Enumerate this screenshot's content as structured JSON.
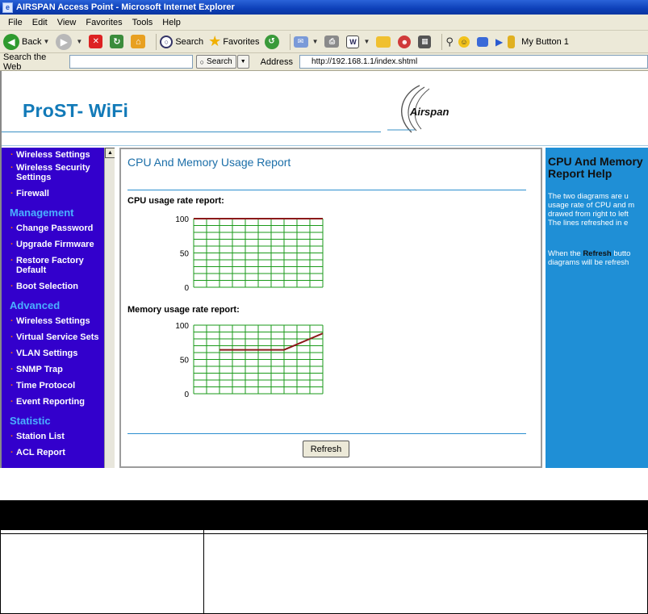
{
  "browser": {
    "title": "AIRSPAN Access Point - Microsoft Internet Explorer",
    "menu": [
      "File",
      "Edit",
      "View",
      "Favorites",
      "Tools",
      "Help"
    ],
    "toolbar": {
      "back_label": "Back",
      "search_label": "Search",
      "favorites_label": "Favorites",
      "my_button_label": "My Button 1"
    },
    "search_web_label": "Search the Web",
    "search_button_label": "Search",
    "address_label": "Address",
    "address_url": "http://192.168.1.1/index.shtml"
  },
  "banner": {
    "product": "ProST- WiFi",
    "brand": "Airspan"
  },
  "sidebar": {
    "items_top": [
      "Wireless Settings",
      "Wireless Security Settings",
      "Firewall"
    ],
    "management_heading": "Management",
    "management": [
      "Change Password",
      "Upgrade Firmware",
      "Restore Factory Default",
      "Boot Selection"
    ],
    "advanced_heading": "Advanced",
    "advanced": [
      "Wireless Settings",
      "Virtual Service Sets",
      "VLAN Settings",
      "SNMP Trap",
      "Time Protocol",
      "Event Reporting"
    ],
    "statistic_heading": "Statistic",
    "statistic": [
      "Station List",
      "ACL Report"
    ]
  },
  "content": {
    "title": "CPU And Memory Usage Report",
    "cpu_label": "CPU usage rate report:",
    "memory_label": "Memory usage rate report:",
    "refresh_label": "Refresh"
  },
  "chart_data": [
    {
      "type": "line",
      "title": "CPU usage rate report:",
      "yticks": [
        "100",
        "50",
        "0"
      ],
      "ylim": [
        0,
        100
      ],
      "x": [
        0,
        1,
        2,
        3,
        4,
        5,
        6,
        7,
        8,
        9,
        10
      ],
      "values": [
        100,
        100,
        100,
        100,
        100,
        100,
        100,
        100,
        100,
        100,
        100
      ],
      "grid": true,
      "grid_color": "#1a9a1a",
      "line_color": "#8b1a1a"
    },
    {
      "type": "line",
      "title": "Memory usage rate report:",
      "yticks": [
        "100",
        "50",
        "0"
      ],
      "ylim": [
        0,
        100
      ],
      "x": [
        0,
        1,
        2,
        3,
        4,
        5,
        6,
        7,
        8,
        9,
        10
      ],
      "values": [
        null,
        null,
        64,
        64,
        64,
        64,
        64,
        64,
        72,
        80,
        88
      ],
      "grid": true,
      "grid_color": "#1a9a1a",
      "line_color": "#8b1a1a"
    }
  ],
  "help": {
    "title_line1": "CPU And Memory",
    "title_line2": "Report Help",
    "p1": [
      "The two diagrams are u",
      "usage rate of CPU and m",
      "drawed from right to left",
      "The lines refreshed in e"
    ],
    "p2_prefix": "When the ",
    "p2_bold": "Refresh",
    "p2_suffix": " butto",
    "p2_line2": "diagrams will be refresh"
  },
  "colors": {
    "sidebar_bg": "#3300cc",
    "sidebar_heading": "#4ab0ff",
    "help_bg": "#1f8fd6",
    "accent": "#1b6ea8"
  }
}
